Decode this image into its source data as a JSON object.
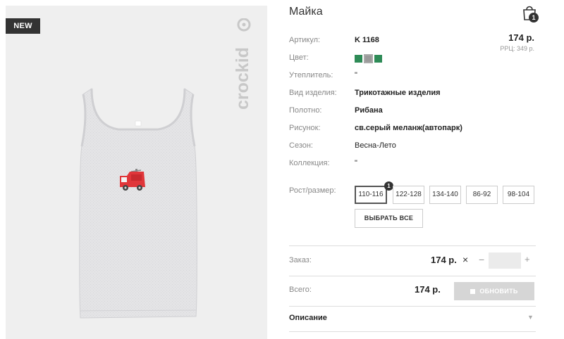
{
  "badge": "NEW",
  "brand": "crockid",
  "product": {
    "title": "Майка",
    "cart_count": "1",
    "price": "174 р.",
    "rrp": "РРЦ: 349 р."
  },
  "attributes": [
    {
      "label": "Артикул:",
      "value": "K 1168"
    },
    {
      "label": "Цвет:",
      "value": ""
    },
    {
      "label": "Утеплитель:",
      "value": "\""
    },
    {
      "label": "Вид изделия:",
      "value": "Трикотажные изделия"
    },
    {
      "label": "Полотно:",
      "value": "Рибана"
    },
    {
      "label": "Рисунок:",
      "value": "св.серый меланж(автопарк)"
    },
    {
      "label": "Сезон:",
      "value": "Весна-Лето"
    },
    {
      "label": "Коллекция:",
      "value": "\""
    }
  ],
  "colors": [
    "#2e8b57",
    "#9a9a9a",
    "#2e8b57"
  ],
  "size_label": "Рост/размер:",
  "sizes": [
    {
      "label": "110-116",
      "count": "1"
    },
    {
      "label": "122-128"
    },
    {
      "label": "134-140"
    },
    {
      "label": "86-92"
    },
    {
      "label": "98-104"
    }
  ],
  "select_all": "ВЫБРАТЬ ВСЕ",
  "order": {
    "label": "Заказ:",
    "price": "174 р.",
    "times": "×",
    "minus": "−",
    "plus": "+",
    "quantity": ""
  },
  "total": {
    "label": "Всего:",
    "price": "174 р.",
    "update": "ОБНОВИТЬ"
  },
  "description": {
    "label": "Описание",
    "arrow": "▼"
  }
}
